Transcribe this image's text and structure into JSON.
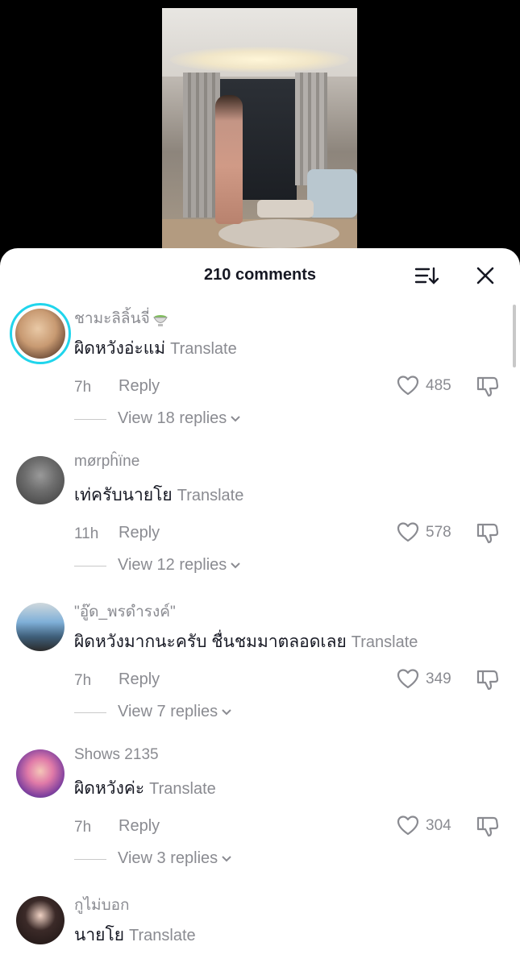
{
  "header": {
    "count_label": "210 comments"
  },
  "comments": [
    {
      "username": "ชามะลิลิ้นจี่",
      "username_emoji": "matcha-bowl",
      "text": "ผิดหวังอ่ะแม่",
      "translate": "Translate",
      "time": "7h",
      "reply": "Reply",
      "likes": "485",
      "view_replies": "View 18 replies"
    },
    {
      "username": "mørpĥïne",
      "text": "เท่ครับนายโย",
      "translate": "Translate",
      "time": "11h",
      "reply": "Reply",
      "likes": "578",
      "view_replies": "View 12 replies"
    },
    {
      "username": "\"อู๊ด_พรดำรงค์\"",
      "text": "ผิดหวังมากนะครับ ชื่นชมมาตลอดเลย",
      "translate": "Translate",
      "time": "7h",
      "reply": "Reply",
      "likes": "349",
      "view_replies": "View 7 replies"
    },
    {
      "username": "Shows 2135",
      "text": "ผิดหวังค่ะ",
      "translate": "Translate",
      "time": "7h",
      "reply": "Reply",
      "likes": "304",
      "view_replies": "View 3 replies"
    },
    {
      "username": "กูไม่บอก",
      "text": "นายโย",
      "translate": "Translate"
    }
  ],
  "colors": {
    "accent_ring": "#20d5ec",
    "muted": "#8a8b91",
    "text": "#161823"
  }
}
